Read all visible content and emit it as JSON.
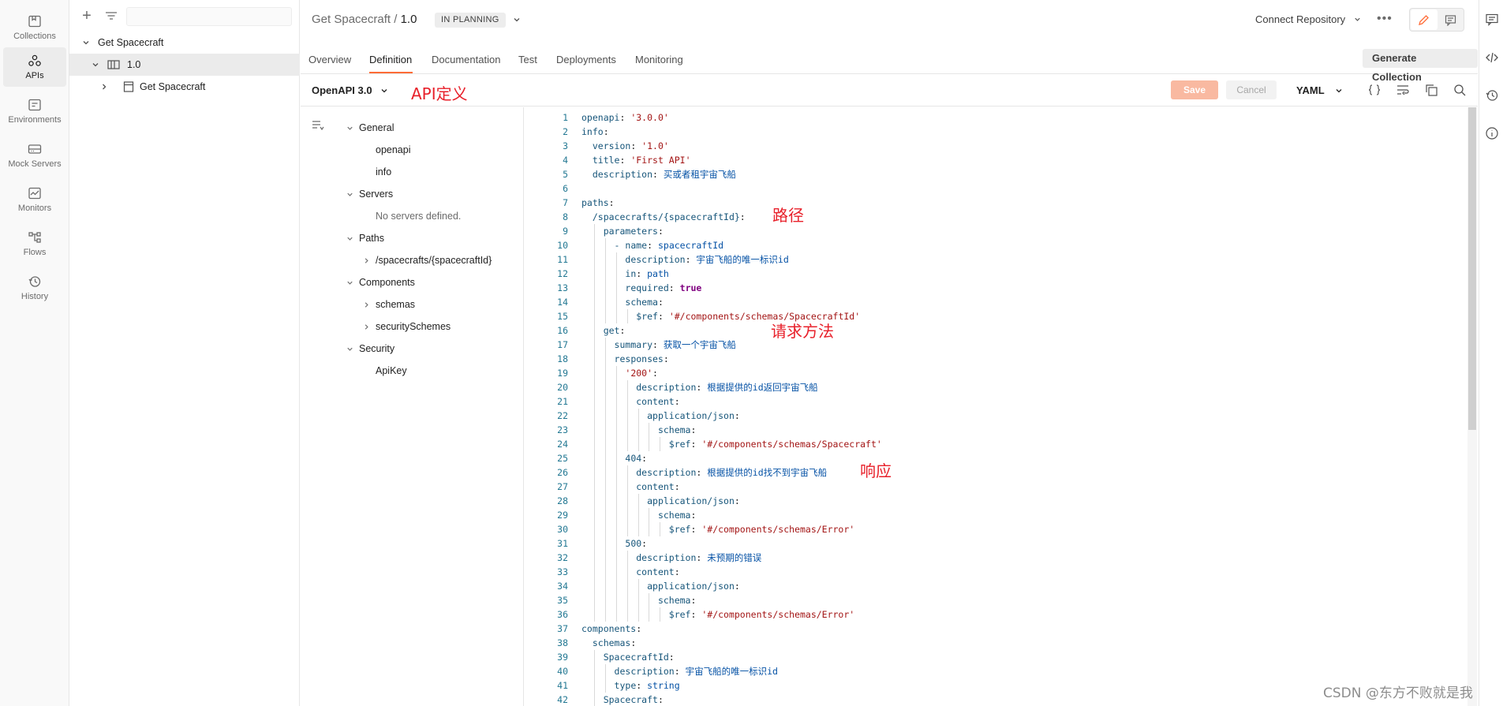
{
  "rail": {
    "items": [
      {
        "label": "Collections",
        "icon": "collections-icon"
      },
      {
        "label": "APIs",
        "icon": "apis-icon"
      },
      {
        "label": "Environments",
        "icon": "environments-icon"
      },
      {
        "label": "Mock Servers",
        "icon": "mock-servers-icon"
      },
      {
        "label": "Monitors",
        "icon": "monitors-icon"
      },
      {
        "label": "Flows",
        "icon": "flows-icon"
      },
      {
        "label": "History",
        "icon": "history-icon"
      }
    ],
    "active_index": 1,
    "accent_color": "#ff6c37"
  },
  "sidebar": {
    "tree": [
      {
        "label": "Get Spacecraft"
      },
      {
        "label": "1.0"
      },
      {
        "label": "Get Spacecraft"
      }
    ]
  },
  "header": {
    "api_name": "Get Spacecraft",
    "separator": "/",
    "version": "1.0",
    "status_badge": "IN PLANNING",
    "connect_repo": "Connect Repository",
    "more": "•••"
  },
  "tabs": {
    "items": [
      "Overview",
      "Definition",
      "Documentation",
      "Test",
      "Deployments",
      "Monitoring"
    ],
    "active": "Definition",
    "generate_label": "Generate Collection"
  },
  "toolbar": {
    "spec_format": "OpenAPI 3.0",
    "save_label": "Save",
    "cancel_label": "Cancel",
    "lang": "YAML"
  },
  "annotations": {
    "api_def": "API定义",
    "path": "路径",
    "method": "请求方法",
    "response": "响应"
  },
  "outline": {
    "general": "General",
    "openapi": "openapi",
    "info": "info",
    "servers": "Servers",
    "no_servers": "No servers defined.",
    "paths": "Paths",
    "path_item": "/spacecrafts/{spacecraftId}",
    "components": "Components",
    "schemas": "schemas",
    "security_schemes": "securitySchemes",
    "security": "Security",
    "apikey": "ApiKey"
  },
  "editor": {
    "lines": [
      "openapi: '3.0.0'",
      "info:",
      "  version: '1.0'",
      "  title: 'First API'",
      "  description: 买或者租宇宙飞船",
      "",
      "paths:",
      "  /spacecrafts/{spacecraftId}:",
      "    parameters:",
      "      - name: spacecraftId",
      "        description: 宇宙飞船的唯一标识id",
      "        in: path",
      "        required: true",
      "        schema:",
      "          $ref: '#/components/schemas/SpacecraftId'",
      "    get:",
      "      summary: 获取一个宇宙飞船",
      "      responses:",
      "        '200':",
      "          description: 根据提供的id返回宇宙飞船",
      "          content:",
      "            application/json:",
      "              schema:",
      "                $ref: '#/components/schemas/Spacecraft'",
      "        404:",
      "          description: 根据提供的id找不到宇宙飞船",
      "          content:",
      "            application/json:",
      "              schema:",
      "                $ref: '#/components/schemas/Error'",
      "        500:",
      "          description: 未预期的错误",
      "          content:",
      "            application/json:",
      "              schema:",
      "                $ref: '#/components/schemas/Error'",
      "components:",
      "  schemas:",
      "    SpacecraftId:",
      "      description: 宇宙飞船的唯一标识id",
      "      type: string",
      "    Spacecraft:"
    ]
  },
  "watermark": "CSDN @东方不败就是我"
}
